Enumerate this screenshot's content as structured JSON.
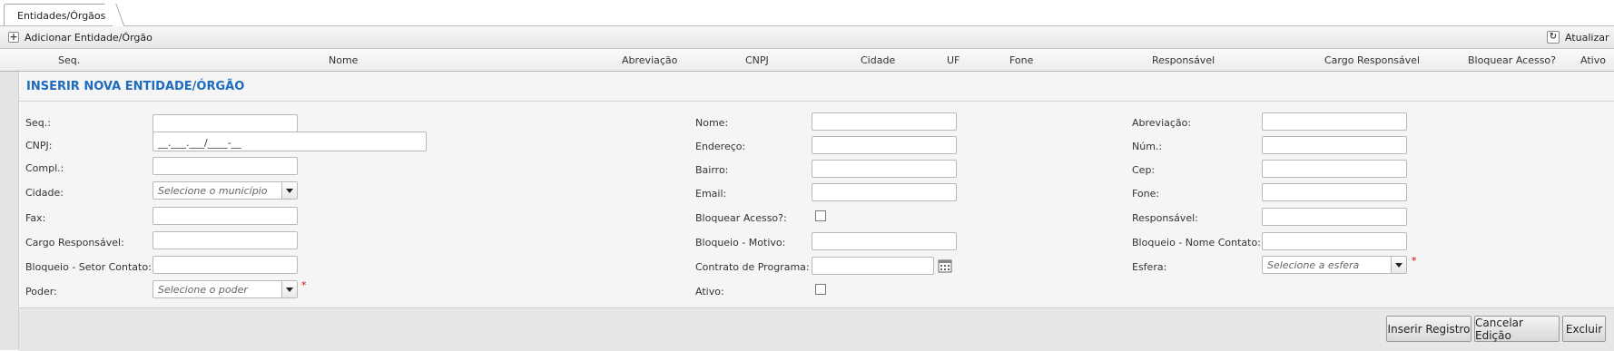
{
  "tabs": [
    {
      "label": "Entidades/Órgãos"
    }
  ],
  "toolbar": {
    "add_label": "Adicionar Entidade/Órgão",
    "refresh_label": "Atualizar"
  },
  "grid": {
    "columns": [
      "Seq.",
      "Nome",
      "Abreviação",
      "CNPJ",
      "Cidade",
      "UF",
      "Fone",
      "Responsável",
      "Cargo Responsável",
      "Bloquear Acesso?",
      "Ativo"
    ]
  },
  "form": {
    "title": "INSERIR NOVA ENTIDADE/ÓRGÃO",
    "col1": {
      "seq": "Seq.:",
      "cnpj": "CNPJ:",
      "cnpj_value": "__.___.___/____-__",
      "compl": "Compl.:",
      "cidade": "Cidade:",
      "cidade_placeholder": "Selecione o município",
      "fax": "Fax:",
      "cargo": "Cargo Responsável:",
      "setor": "Bloqueio - Setor Contato:",
      "poder": "Poder:",
      "poder_placeholder": "Selecione o poder"
    },
    "col2": {
      "nome": "Nome:",
      "endereco": "Endereço:",
      "bairro": "Bairro:",
      "email": "Email:",
      "bloquear": "Bloquear Acesso?:",
      "motivo": "Bloqueio - Motivo:",
      "contrato": "Contrato de Programa:",
      "ativo": "Ativo:"
    },
    "col3": {
      "abrev": "Abreviação:",
      "num": "Núm.:",
      "cep": "Cep:",
      "fone": "Fone:",
      "resp": "Responsável:",
      "nome_contato": "Bloqueio - Nome Contato:",
      "esfera": "Esfera:",
      "esfera_placeholder": "Selecione a esfera"
    },
    "required_mark": "*"
  },
  "buttons": {
    "insert": "Inserir Registro",
    "cancel": "Cancelar Edição",
    "delete": "Excluir"
  },
  "icons": {
    "add": "plus-icon",
    "refresh": "refresh-icon",
    "calendar": "calendar-icon",
    "dropdown": "chevron-down-icon"
  },
  "colors": {
    "title": "#1e6bbf",
    "required": "#dd0000"
  }
}
